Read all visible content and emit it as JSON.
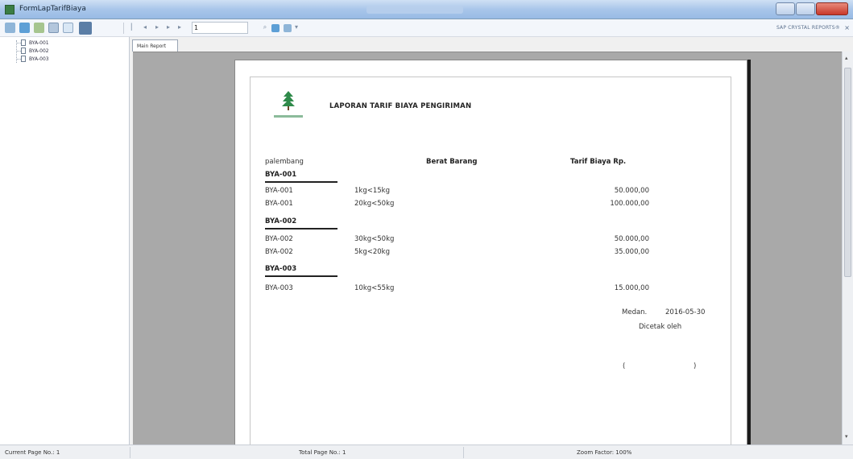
{
  "window": {
    "title": "FormLapTarifBiaya"
  },
  "toolbar": {
    "page_value": "1",
    "crystal_label": "SAP CRYSTAL REPORTS®",
    "close_glyph": "×",
    "icons": [
      "export-icon",
      "print-icon",
      "refresh-icon",
      "copy-icon",
      "toggle-tree-icon",
      "toggle-param-icon",
      "first-page-icon",
      "previous-page-icon",
      "next-page-icon",
      "last-page-icon",
      "goto-page-icon",
      "find-icon",
      "zoom-icon"
    ]
  },
  "tree": {
    "items": [
      "BYA-001",
      "BYA-002",
      "BYA-003"
    ]
  },
  "tabs": {
    "main_label": "Main Report"
  },
  "report": {
    "title": "LAPORAN TARIF BIAYA PENGIRIMAN",
    "city_header": "palembang",
    "col_weight": "Berat Barang",
    "col_tariff": "Tarif Biaya Rp.",
    "groups": [
      {
        "name": "BYA-001",
        "rows": [
          {
            "code": "BYA-001",
            "weight": "1kg<15kg",
            "tariff": "50.000,00"
          },
          {
            "code": "BYA-001",
            "weight": "20kg<50kg",
            "tariff": "100.000,00"
          }
        ]
      },
      {
        "name": "BYA-002",
        "rows": [
          {
            "code": "BYA-002",
            "weight": "30kg<50kg",
            "tariff": "50.000,00"
          },
          {
            "code": "BYA-002",
            "weight": "5kg<20kg",
            "tariff": "35.000,00"
          }
        ]
      },
      {
        "name": "BYA-003",
        "rows": [
          {
            "code": "BYA-003",
            "weight": "10kg<55kg",
            "tariff": "15.000,00"
          }
        ]
      }
    ],
    "footer": {
      "city": "Medan.",
      "date": "2016-05-30",
      "printed_by": "Dicetak oleh",
      "open_paren": "(",
      "close_paren": ")"
    }
  },
  "status": {
    "current_page": "Current Page No.: 1",
    "total_page": "Total Page No.: 1",
    "zoom": "Zoom Factor: 100%"
  }
}
